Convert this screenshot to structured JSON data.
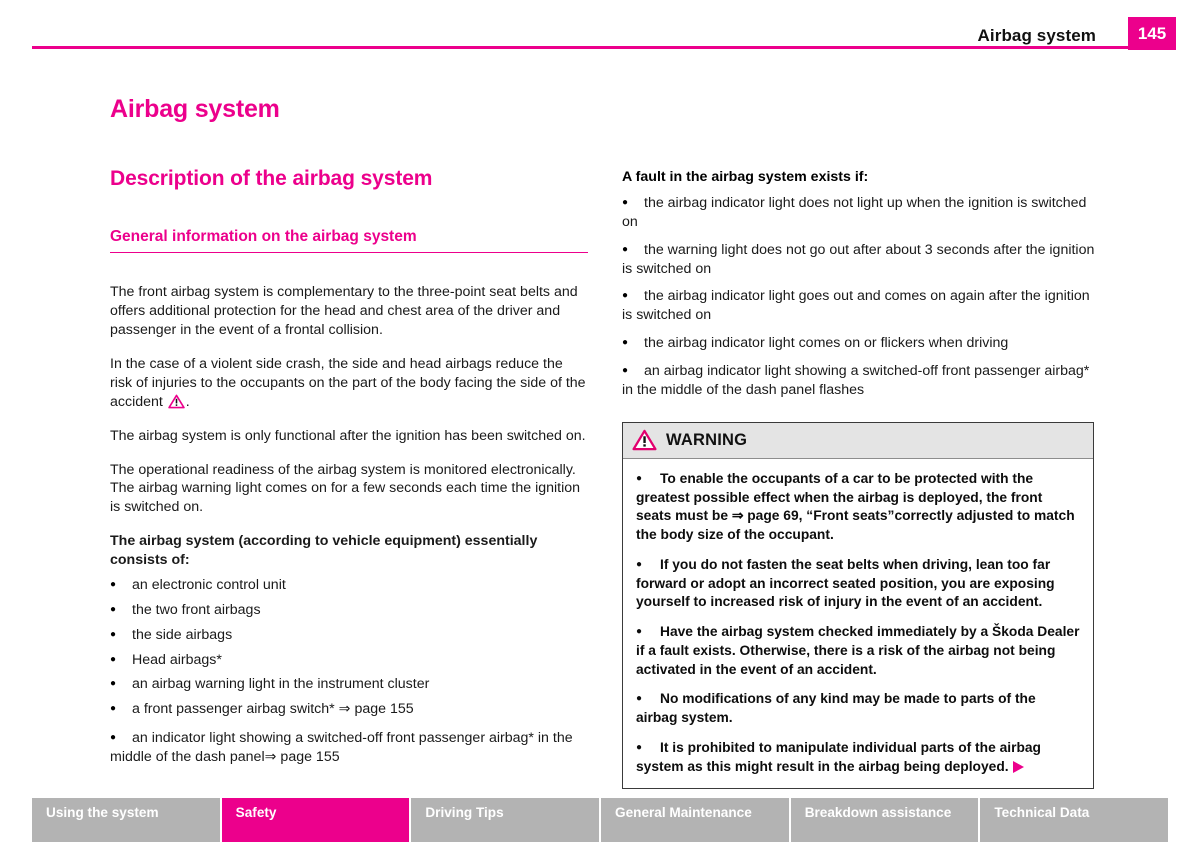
{
  "header": {
    "title": "Airbag system",
    "page_number": "145",
    "accent_color": "#ec008c"
  },
  "left_column": {
    "chapter_title": "Airbag system",
    "section_title": "Description of the airbag system",
    "subsection_title": "General information on the airbag system",
    "paragraphs": [
      "The front airbag system is complementary to the three-point seat belts and offers additional protection for the head and chest area of the driver and passenger in the event of a frontal collision.",
      "The airbag system is only functional after the ignition has been switched on.",
      "The operational readiness of the airbag system is monitored electronically. The airbag warning light comes on for a few seconds each time the ignition is switched on."
    ],
    "side_crash_paragraph_part1": "In the case of a violent side crash, the side and head airbags reduce the risk of injuries to the occupants on the part of the body facing the side of the accident ",
    "side_crash_arrow": "⇒",
    "side_crash_paragraph_part2": ".",
    "consists_heading": "The airbag system (according to vehicle equipment) essentially consists of:",
    "components": [
      "an electronic control unit",
      "the two front airbags",
      "the side airbags",
      "Head airbags*",
      "an airbag warning light in the instrument cluster",
      "a front passenger airbag switch* ⇒ page 155",
      "an indicator light showing a switched-off front passenger airbag* in the middle of the dash panel⇒ page 155"
    ],
    "bullet_glyph": "●"
  },
  "right_column": {
    "fault_heading": "A fault in the airbag system exists if:",
    "fault_items": [
      "the airbag indicator light does not light up when the ignition is switched on",
      "the warning light does not go out after about 3 seconds after the ignition is switched on",
      "the airbag indicator light goes out and comes on again after the ignition is switched on",
      "the airbag indicator light comes on or flickers when driving",
      "an airbag indicator light showing a switched-off front passenger airbag* in the middle of the dash panel flashes"
    ],
    "bullet_glyph": "●"
  },
  "warning_box": {
    "label": "WARNING",
    "icon": "warning-triangle-icon",
    "bullet_glyph": "●",
    "items": [
      "To enable the occupants of a car to be protected with the greatest possible effect when the airbag is deployed, the front seats must be ⇒ page 69, “Front seats”correctly adjusted to match the body size of the occupant.",
      "If you do not fasten the seat belts when driving, lean too far forward or adopt an incorrect seated position, you are exposing yourself to increased risk of injury in the event of an accident.",
      "Have the airbag system checked immediately by a Škoda Dealer if a fault exists. Otherwise, there is a risk of the airbag not being activated in the event of an accident.",
      "No modifications of any kind may be made to parts of the airbag system.",
      "It is prohibited to manipulate individual parts of the airbag system as this might result in the airbag being deployed."
    ],
    "continuation_marker": "▶"
  },
  "bottom_nav": {
    "tabs": [
      {
        "label": "Using the system",
        "active": false
      },
      {
        "label": "Safety",
        "active": true
      },
      {
        "label": "Driving Tips",
        "active": false
      },
      {
        "label": "General Maintenance",
        "active": false
      },
      {
        "label": "Breakdown assistance",
        "active": false
      },
      {
        "label": "Technical Data",
        "active": false
      }
    ]
  }
}
